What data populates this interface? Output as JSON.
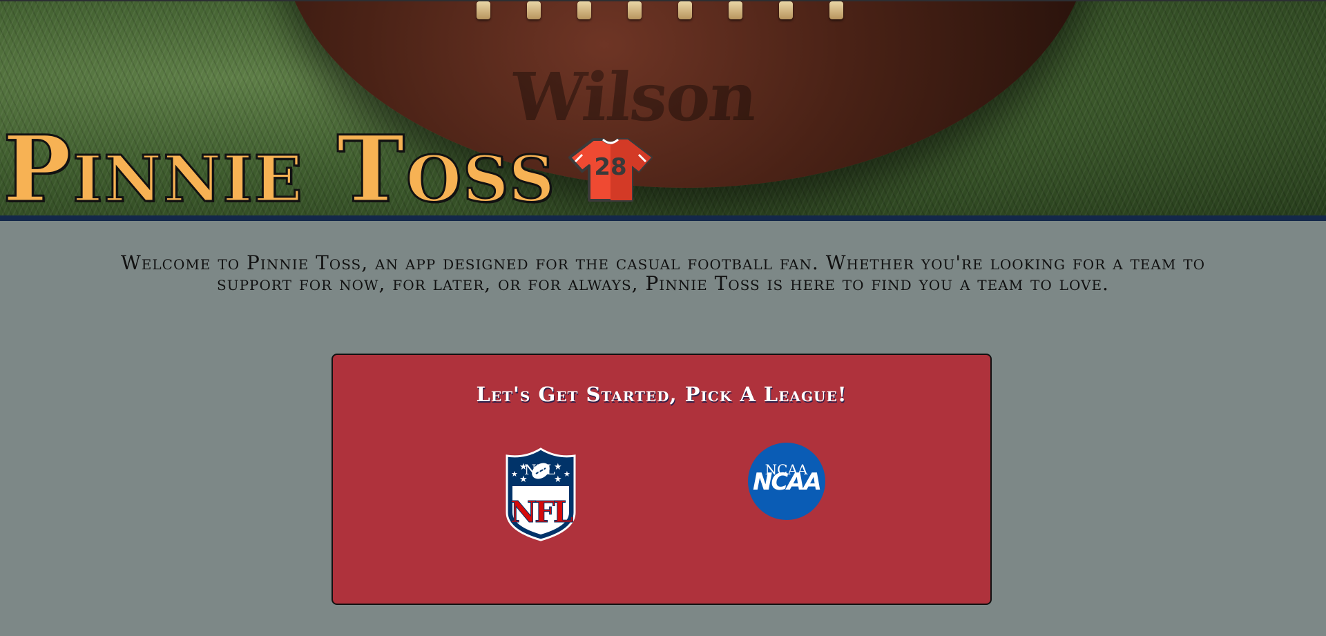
{
  "header": {
    "app_title": "Pinnie Toss",
    "jersey_number": "28",
    "ball_brand": "Wilson"
  },
  "welcome_text": "Welcome to Pinnie Toss, an app designed for the casual football fan. Whether you're looking for a team to support for now, for later, or for always, Pinnie Toss is here to find you a team to love.",
  "league_picker": {
    "title": "Let's Get Started, Pick A League!",
    "leagues": [
      {
        "label": "NFL",
        "logo": "nfl-logo-icon"
      },
      {
        "label": "NCAA",
        "logo": "ncaa-logo-icon",
        "logo_text": "NCAA"
      }
    ]
  },
  "colors": {
    "page_background": "#7d8887",
    "title_orange": "#f7b254",
    "card_red": "#af323c",
    "banner_stripe": "#14284a",
    "ncaa_blue": "#0a5cb5",
    "nfl_navy": "#013369",
    "nfl_red": "#d50a0a"
  }
}
